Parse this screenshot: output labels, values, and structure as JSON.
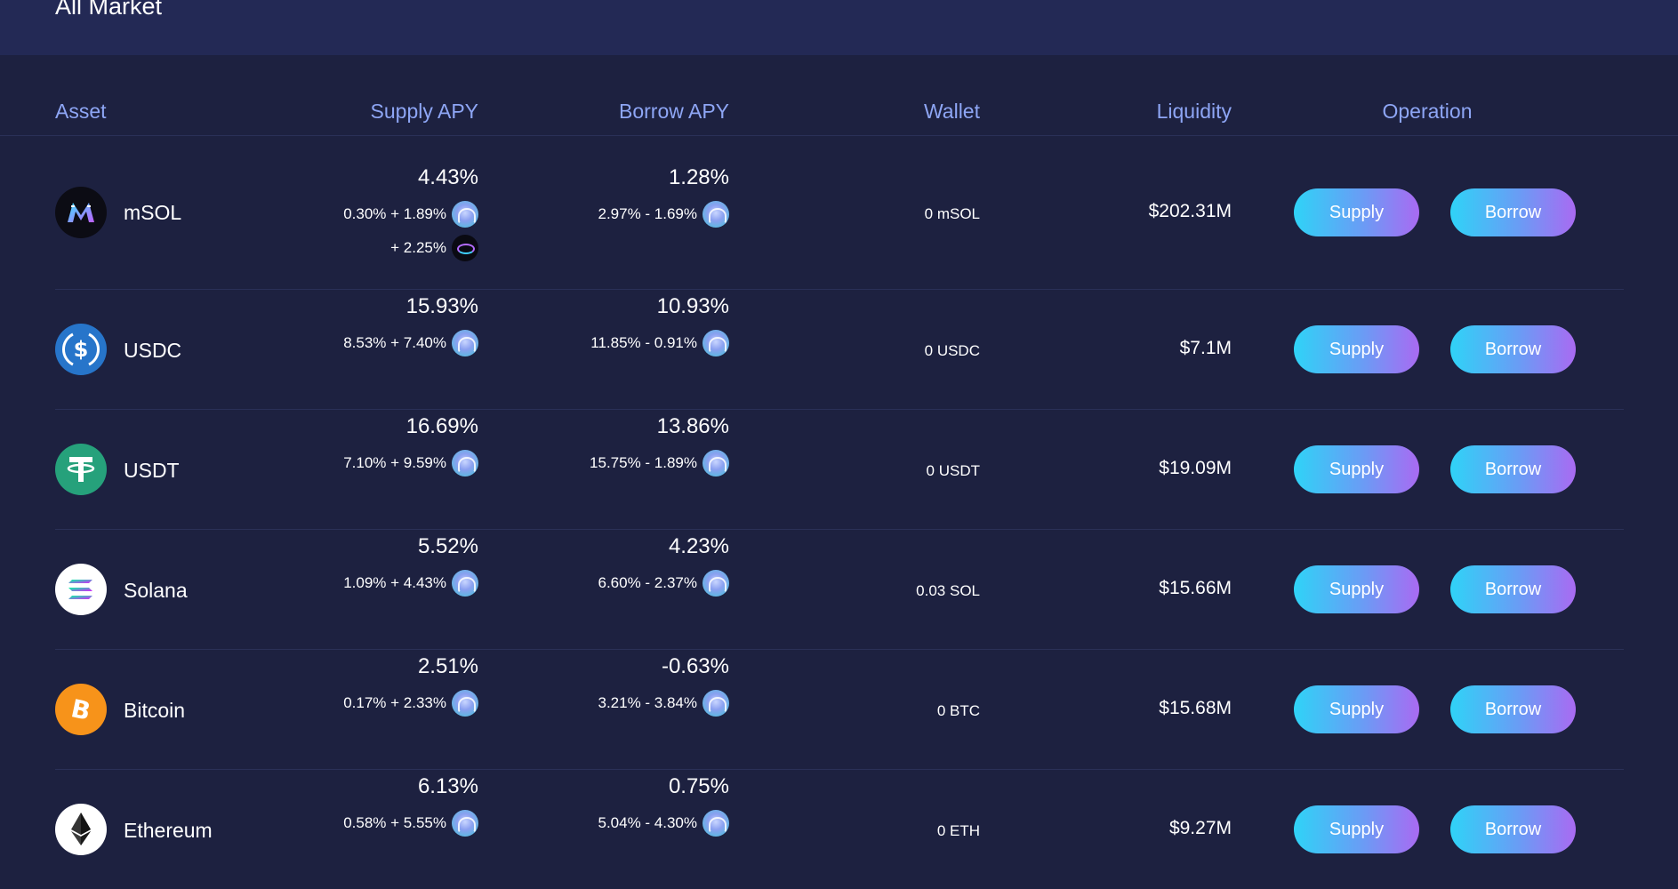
{
  "page": {
    "title": "All Market"
  },
  "columns": {
    "asset": "Asset",
    "supply_apy": "Supply APY",
    "borrow_apy": "Borrow APY",
    "wallet": "Wallet",
    "liquidity": "Liquidity",
    "operation": "Operation"
  },
  "rows": [
    {
      "name": "mSOL",
      "icon": "msol-icon",
      "supply_apy": "4.43%",
      "supply_detail": "0.30% + 1.89%",
      "supply_extra": "+ 2.25%",
      "borrow_apy": "1.28%",
      "borrow_detail": "2.97% - 1.69%",
      "wallet": "0 mSOL",
      "liquidity": "$202.31M",
      "supply_label": "Supply",
      "borrow_label": "Borrow"
    },
    {
      "name": "USDC",
      "icon": "usdc-icon",
      "supply_apy": "15.93%",
      "supply_detail": "8.53% + 7.40%",
      "borrow_apy": "10.93%",
      "borrow_detail": "11.85% - 0.91%",
      "wallet": "0 USDC",
      "liquidity": "$7.1M",
      "supply_label": "Supply",
      "borrow_label": "Borrow"
    },
    {
      "name": "USDT",
      "icon": "usdt-icon",
      "supply_apy": "16.69%",
      "supply_detail": "7.10% + 9.59%",
      "borrow_apy": "13.86%",
      "borrow_detail": "15.75% - 1.89%",
      "wallet": "0 USDT",
      "liquidity": "$19.09M",
      "supply_label": "Supply",
      "borrow_label": "Borrow"
    },
    {
      "name": "Solana",
      "icon": "solana-icon",
      "supply_apy": "5.52%",
      "supply_detail": "1.09% + 4.43%",
      "borrow_apy": "4.23%",
      "borrow_detail": "6.60% - 2.37%",
      "wallet": "0.03 SOL",
      "liquidity": "$15.66M",
      "supply_label": "Supply",
      "borrow_label": "Borrow"
    },
    {
      "name": "Bitcoin",
      "icon": "bitcoin-icon",
      "supply_apy": "2.51%",
      "supply_detail": "0.17% + 2.33%",
      "borrow_apy": "-0.63%",
      "borrow_detail": "3.21% - 3.84%",
      "wallet": "0 BTC",
      "liquidity": "$15.68M",
      "supply_label": "Supply",
      "borrow_label": "Borrow"
    },
    {
      "name": "Ethereum",
      "icon": "ethereum-icon",
      "supply_apy": "6.13%",
      "supply_detail": "0.58% + 5.55%",
      "borrow_apy": "0.75%",
      "borrow_detail": "5.04% - 4.30%",
      "wallet": "0 ETH",
      "liquidity": "$9.27M",
      "supply_label": "Supply",
      "borrow_label": "Borrow"
    }
  ],
  "colors": {
    "background": "#1d2140",
    "top_bar": "#232955",
    "header_text": "#8ea6f5",
    "button_gradient_start": "#2fd3f7",
    "button_gradient_end": "#a96af2"
  }
}
